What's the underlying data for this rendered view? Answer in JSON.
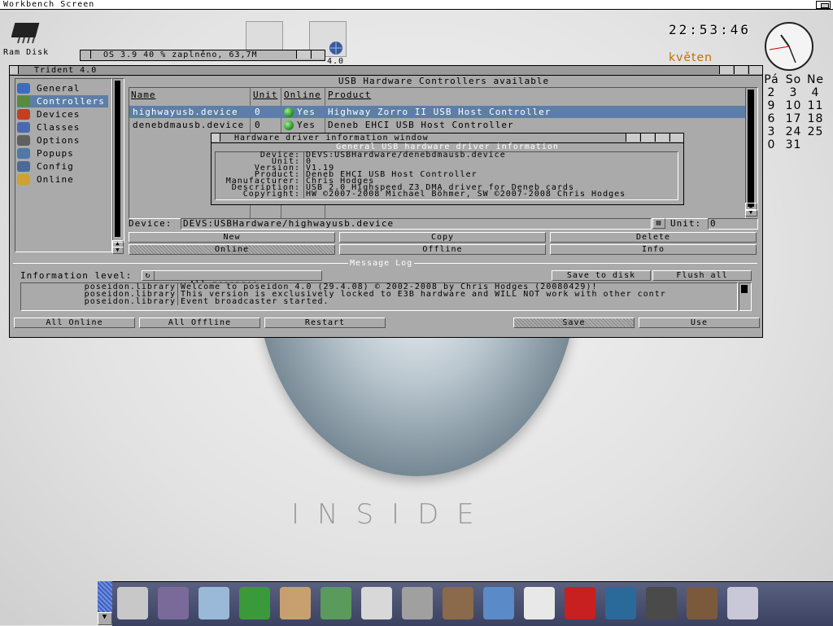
{
  "screen": {
    "title": "Workbench Screen"
  },
  "desktop": {
    "ram_disk_label": "Ram Disk",
    "drive_label": "4.0",
    "clock_time": "22:53:46",
    "month": "květen",
    "calendar": [
      [
        "Pá",
        "So",
        "Ne"
      ],
      [
        "2",
        "3",
        "4"
      ],
      [
        "9",
        "10",
        "11"
      ],
      [
        "6",
        "17",
        "18"
      ],
      [
        "3",
        "24",
        "25"
      ],
      [
        "0",
        "31",
        ""
      ]
    ],
    "inside_text": "INSIDE"
  },
  "workbench_window": {
    "title": "OS 3.9  40 % zaplněno, 63,7M"
  },
  "trident": {
    "title": "Trident 4.0",
    "sidebar": [
      {
        "label": "General",
        "icon": "help-icon",
        "color": "#3d6bbf"
      },
      {
        "label": "Controllers",
        "icon": "chip-icon",
        "color": "#5a8a3a",
        "selected": true
      },
      {
        "label": "Devices",
        "icon": "devices-icon",
        "color": "#c04020"
      },
      {
        "label": "Classes",
        "icon": "classes-icon",
        "color": "#4a6ab0"
      },
      {
        "label": "Options",
        "icon": "options-icon",
        "color": "#606060"
      },
      {
        "label": "Popups",
        "icon": "popups-icon",
        "color": "#5078a8"
      },
      {
        "label": "Config",
        "icon": "config-icon",
        "color": "#4a6a9a"
      },
      {
        "label": "Online",
        "icon": "online-icon",
        "color": "#d0a030"
      }
    ],
    "controllers_header": "USB Hardware Controllers available",
    "columns": [
      "Name",
      "Unit",
      "Online",
      "Product"
    ],
    "rows": [
      {
        "name": "highwayusb.device",
        "unit": "0",
        "online": "Yes",
        "product": "Highway Zorro II USB Host Controller",
        "selected": true
      },
      {
        "name": "denebdmausb.device",
        "unit": "0",
        "online": "Yes",
        "product": "Deneb EHCI USB Host Controller",
        "selected": false
      }
    ],
    "device_label": "Device:",
    "device_value": "DEVS:USBHardware/highwayusb.device",
    "unit_label": "Unit:",
    "unit_value": "0",
    "buttons_row1": [
      "New",
      "Copy",
      "Delete"
    ],
    "buttons_row2": [
      "Online",
      "Offline",
      "Info"
    ],
    "message_log_title": "Message Log",
    "info_level_label": "Information level:",
    "info_level_value": "All messages",
    "save_to_disk": "Save to disk",
    "flush_all": "Flush all",
    "log": [
      {
        "src": "poseidon.library",
        "msg": "Welcome to poseidon 4.0 (29.4.08) © 2002-2008 by Chris Hodges (20080429)!"
      },
      {
        "src": "poseidon.library",
        "msg": "This version is exclusively locked to E3B hardware and WILL NOT work with other contr"
      },
      {
        "src": "poseidon.library",
        "msg": "Event broadcaster started."
      }
    ],
    "bottom_buttons": [
      "All Online",
      "All Offline",
      "Restart",
      "Save",
      "Use"
    ]
  },
  "info_window": {
    "title": "Hardware driver information window",
    "header": "General USB hardware driver information",
    "fields": [
      {
        "label": "Device:",
        "value": "DEVS:USBHardware/denebdmausb.device"
      },
      {
        "label": "Unit:",
        "value": "0"
      },
      {
        "label": "Version:",
        "value": "V1.19"
      },
      {
        "label": "Product:",
        "value": "Deneb EHCI USB Host Controller"
      },
      {
        "label": "Manufacturer:",
        "value": "Chris Hodges"
      },
      {
        "label": "Description:",
        "value": "USB 2.0 Highspeed Z3 DMA driver for Deneb cards"
      },
      {
        "label": "Copyright:",
        "value": "HW ©2007-2008 Michael Böhmer, SW ©2007-2008 Chris Hodges"
      }
    ]
  },
  "taskbar": {
    "icons": [
      "shell-icon",
      "prefs-icon",
      "hippo-icon",
      "notepad-icon",
      "user-icon",
      "box-icon",
      "magnifier-icon",
      "speaker-icon",
      "viewer-icon",
      "disk-icon",
      "spider-icon",
      "ac-icon",
      "globe-icon",
      "media-icon",
      "network-icon",
      "grid-icon"
    ]
  }
}
